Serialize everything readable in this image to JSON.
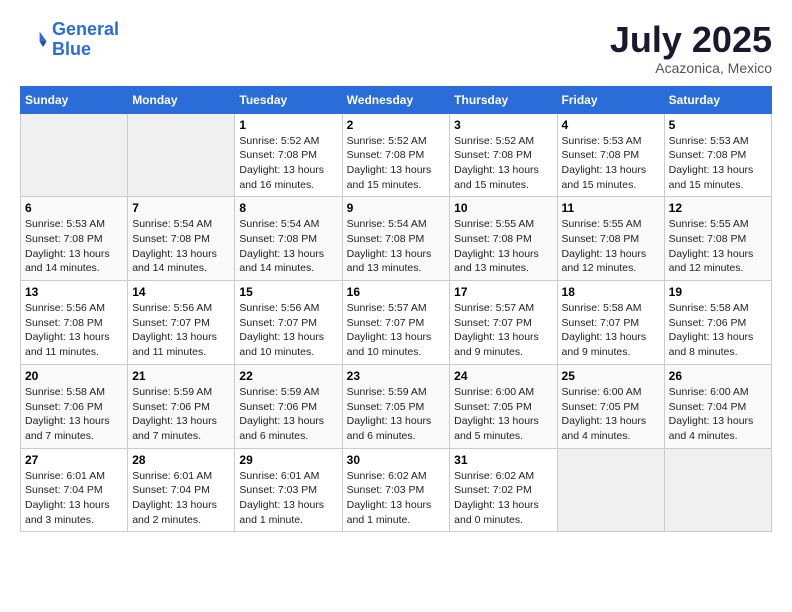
{
  "logo": {
    "line1": "General",
    "line2": "Blue"
  },
  "title": "July 2025",
  "location": "Acazonica, Mexico",
  "weekdays": [
    "Sunday",
    "Monday",
    "Tuesday",
    "Wednesday",
    "Thursday",
    "Friday",
    "Saturday"
  ],
  "weeks": [
    [
      {
        "num": "",
        "info": ""
      },
      {
        "num": "",
        "info": ""
      },
      {
        "num": "1",
        "info": "Sunrise: 5:52 AM\nSunset: 7:08 PM\nDaylight: 13 hours\nand 16 minutes."
      },
      {
        "num": "2",
        "info": "Sunrise: 5:52 AM\nSunset: 7:08 PM\nDaylight: 13 hours\nand 15 minutes."
      },
      {
        "num": "3",
        "info": "Sunrise: 5:52 AM\nSunset: 7:08 PM\nDaylight: 13 hours\nand 15 minutes."
      },
      {
        "num": "4",
        "info": "Sunrise: 5:53 AM\nSunset: 7:08 PM\nDaylight: 13 hours\nand 15 minutes."
      },
      {
        "num": "5",
        "info": "Sunrise: 5:53 AM\nSunset: 7:08 PM\nDaylight: 13 hours\nand 15 minutes."
      }
    ],
    [
      {
        "num": "6",
        "info": "Sunrise: 5:53 AM\nSunset: 7:08 PM\nDaylight: 13 hours\nand 14 minutes."
      },
      {
        "num": "7",
        "info": "Sunrise: 5:54 AM\nSunset: 7:08 PM\nDaylight: 13 hours\nand 14 minutes."
      },
      {
        "num": "8",
        "info": "Sunrise: 5:54 AM\nSunset: 7:08 PM\nDaylight: 13 hours\nand 14 minutes."
      },
      {
        "num": "9",
        "info": "Sunrise: 5:54 AM\nSunset: 7:08 PM\nDaylight: 13 hours\nand 13 minutes."
      },
      {
        "num": "10",
        "info": "Sunrise: 5:55 AM\nSunset: 7:08 PM\nDaylight: 13 hours\nand 13 minutes."
      },
      {
        "num": "11",
        "info": "Sunrise: 5:55 AM\nSunset: 7:08 PM\nDaylight: 13 hours\nand 12 minutes."
      },
      {
        "num": "12",
        "info": "Sunrise: 5:55 AM\nSunset: 7:08 PM\nDaylight: 13 hours\nand 12 minutes."
      }
    ],
    [
      {
        "num": "13",
        "info": "Sunrise: 5:56 AM\nSunset: 7:08 PM\nDaylight: 13 hours\nand 11 minutes."
      },
      {
        "num": "14",
        "info": "Sunrise: 5:56 AM\nSunset: 7:07 PM\nDaylight: 13 hours\nand 11 minutes."
      },
      {
        "num": "15",
        "info": "Sunrise: 5:56 AM\nSunset: 7:07 PM\nDaylight: 13 hours\nand 10 minutes."
      },
      {
        "num": "16",
        "info": "Sunrise: 5:57 AM\nSunset: 7:07 PM\nDaylight: 13 hours\nand 10 minutes."
      },
      {
        "num": "17",
        "info": "Sunrise: 5:57 AM\nSunset: 7:07 PM\nDaylight: 13 hours\nand 9 minutes."
      },
      {
        "num": "18",
        "info": "Sunrise: 5:58 AM\nSunset: 7:07 PM\nDaylight: 13 hours\nand 9 minutes."
      },
      {
        "num": "19",
        "info": "Sunrise: 5:58 AM\nSunset: 7:06 PM\nDaylight: 13 hours\nand 8 minutes."
      }
    ],
    [
      {
        "num": "20",
        "info": "Sunrise: 5:58 AM\nSunset: 7:06 PM\nDaylight: 13 hours\nand 7 minutes."
      },
      {
        "num": "21",
        "info": "Sunrise: 5:59 AM\nSunset: 7:06 PM\nDaylight: 13 hours\nand 7 minutes."
      },
      {
        "num": "22",
        "info": "Sunrise: 5:59 AM\nSunset: 7:06 PM\nDaylight: 13 hours\nand 6 minutes."
      },
      {
        "num": "23",
        "info": "Sunrise: 5:59 AM\nSunset: 7:05 PM\nDaylight: 13 hours\nand 6 minutes."
      },
      {
        "num": "24",
        "info": "Sunrise: 6:00 AM\nSunset: 7:05 PM\nDaylight: 13 hours\nand 5 minutes."
      },
      {
        "num": "25",
        "info": "Sunrise: 6:00 AM\nSunset: 7:05 PM\nDaylight: 13 hours\nand 4 minutes."
      },
      {
        "num": "26",
        "info": "Sunrise: 6:00 AM\nSunset: 7:04 PM\nDaylight: 13 hours\nand 4 minutes."
      }
    ],
    [
      {
        "num": "27",
        "info": "Sunrise: 6:01 AM\nSunset: 7:04 PM\nDaylight: 13 hours\nand 3 minutes."
      },
      {
        "num": "28",
        "info": "Sunrise: 6:01 AM\nSunset: 7:04 PM\nDaylight: 13 hours\nand 2 minutes."
      },
      {
        "num": "29",
        "info": "Sunrise: 6:01 AM\nSunset: 7:03 PM\nDaylight: 13 hours\nand 1 minute."
      },
      {
        "num": "30",
        "info": "Sunrise: 6:02 AM\nSunset: 7:03 PM\nDaylight: 13 hours\nand 1 minute."
      },
      {
        "num": "31",
        "info": "Sunrise: 6:02 AM\nSunset: 7:02 PM\nDaylight: 13 hours\nand 0 minutes."
      },
      {
        "num": "",
        "info": ""
      },
      {
        "num": "",
        "info": ""
      }
    ]
  ]
}
